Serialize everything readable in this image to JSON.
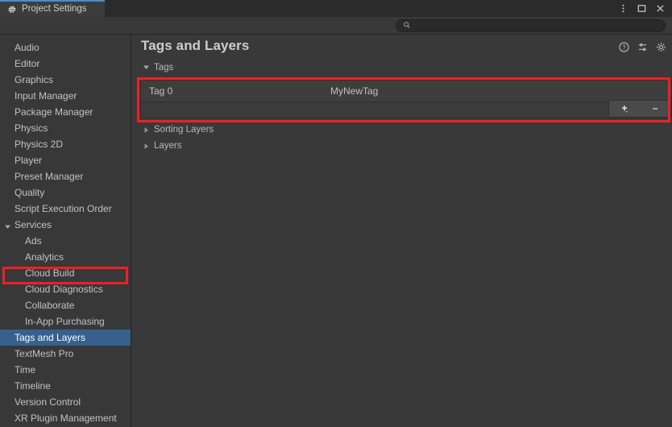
{
  "window": {
    "tab_label": "Project Settings",
    "tab_icon": "gear-icon",
    "controls": {
      "menu": "kebab-menu-icon",
      "maximize": "maximize-icon",
      "close": "close-icon"
    }
  },
  "search": {
    "value": "",
    "placeholder": "",
    "icon": "search-icon"
  },
  "sidebar": {
    "items": [
      {
        "label": "Audio",
        "level": 0,
        "arrow": "none",
        "selected": false
      },
      {
        "label": "Editor",
        "level": 0,
        "arrow": "none",
        "selected": false
      },
      {
        "label": "Graphics",
        "level": 0,
        "arrow": "none",
        "selected": false
      },
      {
        "label": "Input Manager",
        "level": 0,
        "arrow": "none",
        "selected": false
      },
      {
        "label": "Package Manager",
        "level": 0,
        "arrow": "none",
        "selected": false
      },
      {
        "label": "Physics",
        "level": 0,
        "arrow": "none",
        "selected": false
      },
      {
        "label": "Physics 2D",
        "level": 0,
        "arrow": "none",
        "selected": false
      },
      {
        "label": "Player",
        "level": 0,
        "arrow": "none",
        "selected": false
      },
      {
        "label": "Preset Manager",
        "level": 0,
        "arrow": "none",
        "selected": false
      },
      {
        "label": "Quality",
        "level": 0,
        "arrow": "none",
        "selected": false
      },
      {
        "label": "Script Execution Order",
        "level": 0,
        "arrow": "none",
        "selected": false
      },
      {
        "label": "Services",
        "level": 0,
        "arrow": "expanded",
        "selected": false
      },
      {
        "label": "Ads",
        "level": 1,
        "arrow": "none",
        "selected": false
      },
      {
        "label": "Analytics",
        "level": 1,
        "arrow": "none",
        "selected": false
      },
      {
        "label": "Cloud Build",
        "level": 1,
        "arrow": "none",
        "selected": false
      },
      {
        "label": "Cloud Diagnostics",
        "level": 1,
        "arrow": "none",
        "selected": false
      },
      {
        "label": "Collaborate",
        "level": 1,
        "arrow": "none",
        "selected": false
      },
      {
        "label": "In-App Purchasing",
        "level": 1,
        "arrow": "none",
        "selected": false
      },
      {
        "label": "Tags and Layers",
        "level": 0,
        "arrow": "none",
        "selected": true
      },
      {
        "label": "TextMesh Pro",
        "level": 0,
        "arrow": "none",
        "selected": false
      },
      {
        "label": "Time",
        "level": 0,
        "arrow": "none",
        "selected": false
      },
      {
        "label": "Timeline",
        "level": 0,
        "arrow": "none",
        "selected": false
      },
      {
        "label": "Version Control",
        "level": 0,
        "arrow": "none",
        "selected": false
      },
      {
        "label": "XR Plugin Management",
        "level": 0,
        "arrow": "none",
        "selected": false
      }
    ]
  },
  "main": {
    "title": "Tags and Layers",
    "header_icons": [
      {
        "name": "help-icon",
        "glyph": "?"
      },
      {
        "name": "preset-icon",
        "glyph": ""
      },
      {
        "name": "gear-icon",
        "glyph": ""
      }
    ],
    "tags_section": {
      "label": "Tags",
      "expanded": true,
      "rows": [
        {
          "index_label": "Tag 0",
          "value": "MyNewTag"
        }
      ],
      "add_button": "+",
      "remove_button": "–"
    },
    "sorting_layers_section": {
      "label": "Sorting Layers",
      "expanded": false
    },
    "layers_section": {
      "label": "Layers",
      "expanded": false
    }
  },
  "annotations": {
    "tags_box_color": "#f01e28",
    "nav_box_color": "#f01e28"
  },
  "colors": {
    "accent_tab": "#4d8cc8",
    "selection": "#36618e",
    "background": "#393939",
    "sidebar": "#383838",
    "titlebar": "#2b2b2b"
  }
}
